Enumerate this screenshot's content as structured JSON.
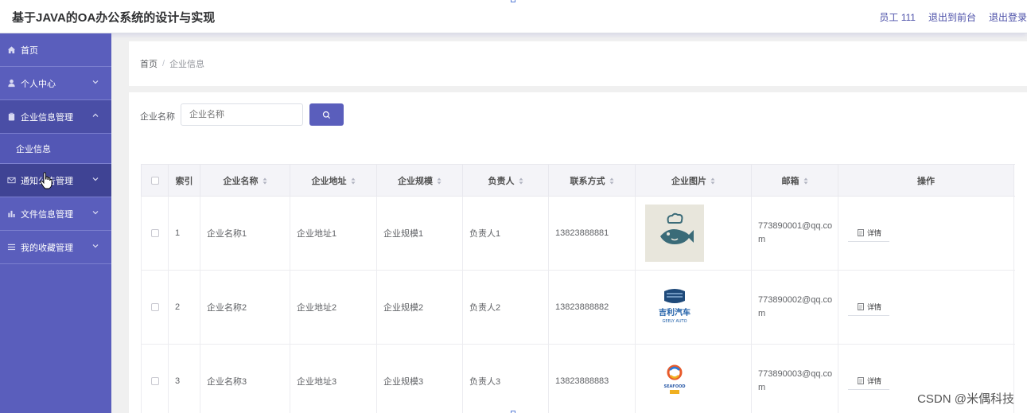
{
  "header": {
    "title": "基于JAVA的OA办公系统的设计与实现",
    "user": "员工 111",
    "back_to_front": "退出到前台",
    "logout": "退出登录"
  },
  "sidebar": {
    "items": [
      {
        "label": "首页",
        "icon": "home-icon"
      },
      {
        "label": "个人中心",
        "icon": "user-icon"
      },
      {
        "label": "企业信息管理",
        "icon": "clipboard-icon"
      },
      {
        "label": "企业信息"
      },
      {
        "label": "通知公告管理",
        "icon": "mail-icon"
      },
      {
        "label": "文件信息管理",
        "icon": "chart-icon"
      },
      {
        "label": "我的收藏管理",
        "icon": "list-icon"
      }
    ]
  },
  "breadcrumb": {
    "home": "首页",
    "separator": "/",
    "current": "企业信息"
  },
  "search": {
    "label": "企业名称",
    "placeholder": "企业名称"
  },
  "table": {
    "columns": [
      "索引",
      "企业名称",
      "企业地址",
      "企业规模",
      "负责人",
      "联系方式",
      "企业图片",
      "邮箱",
      "操作"
    ],
    "rows": [
      {
        "index": "1",
        "name": "企业名称1",
        "address": "企业地址1",
        "scale": "企业规模1",
        "manager": "负责人1",
        "phone": "13823888881",
        "email": "773890001@qq.com",
        "action": "详情"
      },
      {
        "index": "2",
        "name": "企业名称2",
        "address": "企业地址2",
        "scale": "企业规模2",
        "manager": "负责人2",
        "phone": "13823888882",
        "email": "773890002@qq.com",
        "action": "详情",
        "logo_text_1": "吉利汽车",
        "logo_text_2": "GEELY AUTO"
      },
      {
        "index": "3",
        "name": "企业名称3",
        "address": "企业地址3",
        "scale": "企业规模3",
        "manager": "负责人3",
        "phone": "13823888883",
        "email": "773890003@qq.com",
        "action": "详情",
        "logo_text_1": "SEAFOOD"
      }
    ]
  },
  "watermark": "CSDN @米偶科技",
  "colors": {
    "accent": "#5a5ebc",
    "sidebar": "#5a5ebc",
    "sidebar_hover": "#3f4394"
  }
}
